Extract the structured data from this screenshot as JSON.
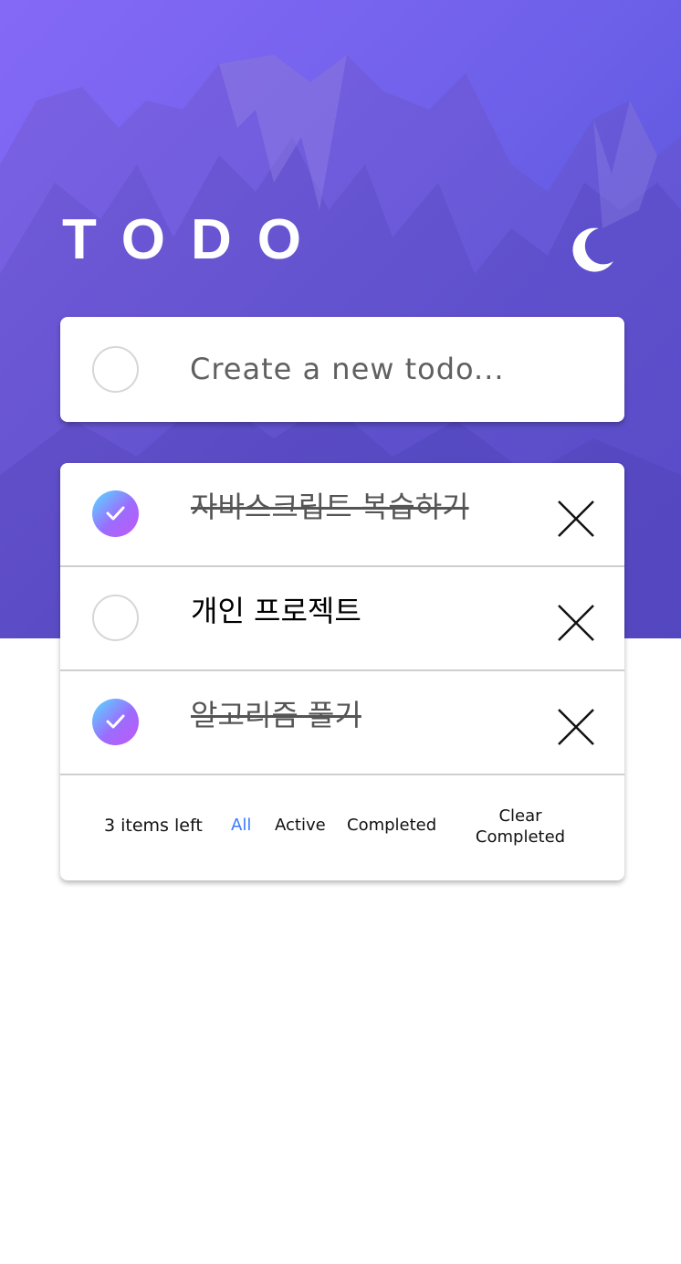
{
  "app": {
    "title": "TODO"
  },
  "theme_toggle": {
    "icon": "moon-icon"
  },
  "new_todo": {
    "placeholder": "Create a new todo..."
  },
  "todos": [
    {
      "text": "자바스크립트 복습하기",
      "completed": true
    },
    {
      "text": "개인 프로젝트",
      "completed": false
    },
    {
      "text": "알고리즘 풀기",
      "completed": true
    }
  ],
  "footer": {
    "items_left": "3 items left",
    "filters": [
      "All",
      "Active",
      "Completed"
    ],
    "active_filter": "All",
    "clear_label": "Clear Completed"
  },
  "colors": {
    "accent": "#3a7bfd",
    "check_gradient_start": "#55ddff",
    "check_gradient_end": "#c058f3",
    "hero_tint": "#6f63e8"
  }
}
